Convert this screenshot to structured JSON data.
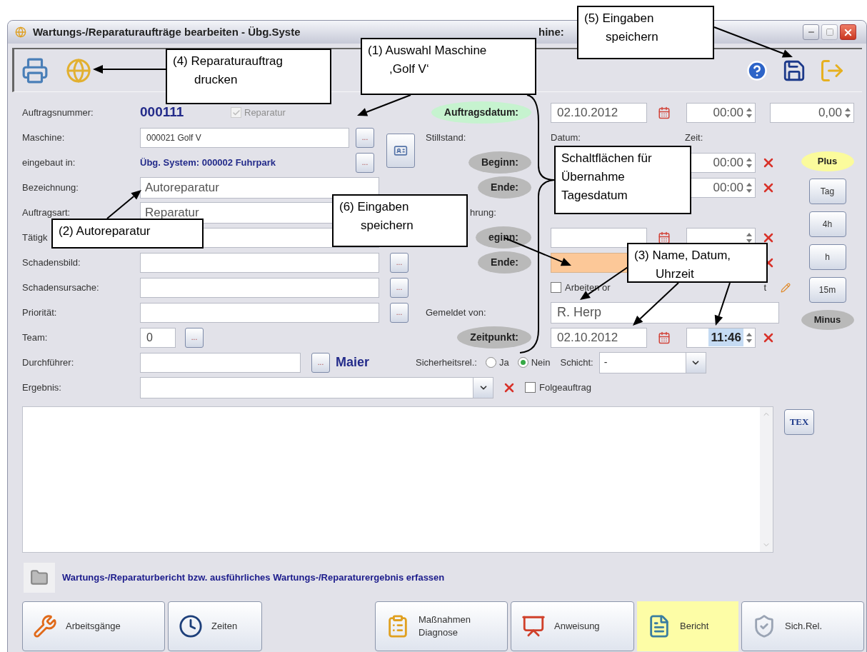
{
  "window": {
    "title": "Wartungs-/Reparaturaufträge bearbeiten - Übg.Syste",
    "title_tail": "hine:"
  },
  "left_rows": [
    {
      "kind": "number",
      "label": "Auftragsnummer:",
      "value": "000111",
      "check_label": "Reparatur",
      "checked": true
    },
    {
      "kind": "machine",
      "label": "Maschine:",
      "value": "000021 Golf V",
      "button": "..."
    },
    {
      "kind": "link",
      "label": "eingebaut in:",
      "value": "Übg. System: 000002 Fuhrpark",
      "button": "..."
    },
    {
      "kind": "text",
      "label": "Bezeichnung:",
      "value": "Autoreparatur"
    },
    {
      "kind": "text",
      "label": "Auftragsart:",
      "value": "Reparatur"
    },
    {
      "kind": "field",
      "label": "Tätigk"
    },
    {
      "kind": "field",
      "label": "Schadensbild:",
      "button": "..."
    },
    {
      "kind": "field",
      "label": "Schadensursache:",
      "button": "..."
    },
    {
      "kind": "field",
      "label": "Priorität:",
      "button": "..."
    },
    {
      "kind": "team",
      "label": "Team:",
      "value": "0",
      "button": "..."
    }
  ],
  "mid_rows": [
    {
      "kind": "oval",
      "text": "Auftragsdatum:",
      "color": "#c6f3cf"
    },
    {
      "kind": "label",
      "text": "Stillstand:"
    },
    {
      "kind": "oval",
      "text": "Beginn:",
      "color": "#b9b9b9"
    },
    {
      "kind": "oval",
      "text": "Ende:",
      "color": "#b9b9b9"
    },
    {
      "kind": "fragment",
      "text": "hrung:"
    },
    {
      "kind": "oval",
      "text": "eginn:",
      "color": "#b9b9b9"
    },
    {
      "kind": "oval",
      "text": "Ende:",
      "color": "#b9b9b9"
    },
    {
      "kind": "blank"
    },
    {
      "kind": "label",
      "text": "Gemeldet von:"
    },
    {
      "kind": "oval",
      "text": "Zeitpunkt:",
      "color": "#b9b9b9"
    }
  ],
  "right_rows": [
    {
      "kind": "datetime",
      "date": "02.10.2012",
      "time": "00:00",
      "time_selected": false,
      "amount": "0,00"
    },
    {
      "kind": "headers",
      "date_label": "Datum:",
      "time_label": "Zeit:"
    },
    {
      "kind": "time",
      "time": "00:00",
      "time_selected": false,
      "clear": true
    },
    {
      "kind": "time",
      "time": "00:00",
      "time_selected": false,
      "clear": true
    },
    {
      "kind": "blank"
    },
    {
      "kind": "datetime",
      "clear": true
    },
    {
      "kind": "warning_date",
      "clear": true
    },
    {
      "kind": "check",
      "label": "Arbeiten or",
      "tail": "t",
      "checked": false
    },
    {
      "kind": "name",
      "value": "R. Herp"
    },
    {
      "kind": "datetime",
      "date": "02.10.2012",
      "time": "11:46",
      "time_selected": true,
      "clear": true
    }
  ],
  "side_buttons": [
    {
      "kind": "oval",
      "text": "Plus",
      "color": "#fbfb9c"
    },
    {
      "kind": "button",
      "text": "Tag"
    },
    {
      "kind": "button",
      "text": "4h"
    },
    {
      "kind": "button",
      "text": "h"
    },
    {
      "kind": "button",
      "text": "15m"
    },
    {
      "kind": "oval",
      "text": "Minus",
      "color": "#b9b9b9"
    }
  ],
  "performer": {
    "label": "Durchführer:",
    "button": "...",
    "name": "Maier"
  },
  "safety": {
    "label": "Sicherheitsrel.:",
    "options": [
      {
        "label": "Ja",
        "selected": false
      },
      {
        "label": "Nein",
        "selected": true
      }
    ],
    "shift_label": "Schicht:",
    "shift_value": "-"
  },
  "result": {
    "label": "Ergebnis:",
    "followup_label": "Folgeauftrag",
    "followup_checked": false
  },
  "tex_label": "TEX",
  "report_hint": "Wartungs-/Reparaturbericht bzw. ausführliches Wartungs-/Reparaturergebnis erfassen",
  "bottom_buttons": [
    {
      "kind": "tasks",
      "lines": [
        "Arbeitsgänge"
      ],
      "selected": false
    },
    {
      "kind": "clock",
      "lines": [
        "Zeiten"
      ],
      "selected": false
    },
    {
      "kind": "clipboard",
      "lines": [
        "Maßnahmen",
        "Diagnose"
      ],
      "selected": false
    },
    {
      "kind": "instruction",
      "lines": [
        "Anweisung"
      ],
      "selected": false
    },
    {
      "kind": "report",
      "lines": [
        "Bericht"
      ],
      "selected": true
    },
    {
      "kind": "safety",
      "lines": [
        "Sich.Rel."
      ],
      "selected": false
    }
  ],
  "callouts": [
    {
      "kind": "numbered",
      "lines": [
        "(5) Eingaben",
        "speichern"
      ]
    },
    {
      "kind": "numbered",
      "lines": [
        "(4) Reparaturauftrag",
        "drucken"
      ]
    },
    {
      "kind": "numbered",
      "lines": [
        "(1) Auswahl Maschine",
        ",Golf V‘"
      ]
    },
    {
      "kind": "plain",
      "lines": [
        "Schaltflächen für",
        "Übernahme",
        "Tagesdatum"
      ]
    },
    {
      "kind": "numbered",
      "lines": [
        "(6) Eingaben",
        "speichern"
      ]
    },
    {
      "kind": "numbered",
      "lines": [
        "(2) Autoreparatur"
      ]
    },
    {
      "kind": "numbered",
      "lines": [
        "(3) Name, Datum,",
        "Uhrzeit"
      ]
    }
  ]
}
